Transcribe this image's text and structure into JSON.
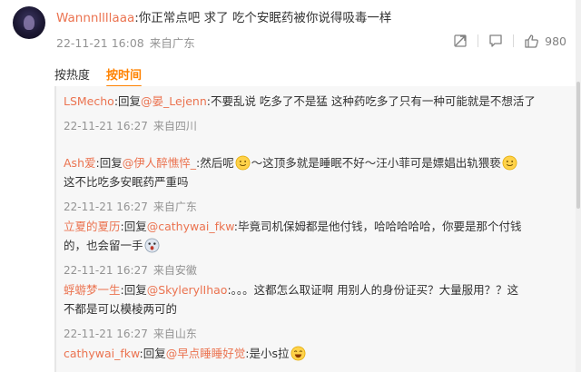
{
  "main_comment": {
    "username": "Wannnllllaaa",
    "text": ":你正常点吧 求了 吃个安眠药被你说得吸毒一样",
    "date": "22-11-21 16:08",
    "location": "来自广东",
    "like_count": "980"
  },
  "sort": {
    "hot_label": "按热度",
    "time_label": "按时间"
  },
  "replies": [
    {
      "user": "LSMecho",
      "reply_word": ":回复",
      "target": "@晏_Lejenn",
      "text": ":不要乱说 吃多了不是猛 这种药吃多了只有一种可能就是不想活了",
      "date": "22-11-21 16:27",
      "location": "来自四川"
    },
    {
      "user": "Ash爱",
      "reply_word": ":回复",
      "target": "@伊人醉憔悴_",
      "text_a": ":然后呢",
      "text_b": "～这顶多就是睡眠不好～汪小菲可是嫖娼出轨猥亵",
      "text_c": "这不比吃多安眠药严重吗",
      "date": "22-11-21 16:27",
      "location": "来自广东"
    },
    {
      "user": "立夏的夏历",
      "reply_word": ":回复",
      "target": "@cathywai_fkw",
      "text_a": ":毕竟司机保姆都是他付钱，哈哈哈哈哈，你要是那个付钱",
      "text_b": "的，也会留一手",
      "date": "22-11-21 16:27",
      "location": "来自安徽"
    },
    {
      "user": "蜉蝣梦一生",
      "reply_word": ":回复",
      "target": "@SkylerylIhao",
      "text_a": ":。。。这都怎么取证啊 用别人的身份证买？大量服用？？这",
      "text_b": "不都是可以模棱两可的",
      "date": "22-11-21 16:27",
      "location": "来自山东"
    },
    {
      "user": "cathywai_fkw",
      "reply_word": ":回复",
      "target": "@早点睡睡好觉",
      "text": ":是小s拉"
    }
  ],
  "icons": {
    "share": "share-icon",
    "comment": "comment-icon",
    "like": "thumbs-up-icon",
    "emoji_smile": "smile-emoji",
    "emoji_shock": "shock-emoji",
    "emoji_laugh": "laugh-emoji"
  },
  "colors": {
    "username": "#eb7350",
    "accent": "#ff8200",
    "meta": "#939393",
    "panel_bg": "#f7f7f7"
  }
}
